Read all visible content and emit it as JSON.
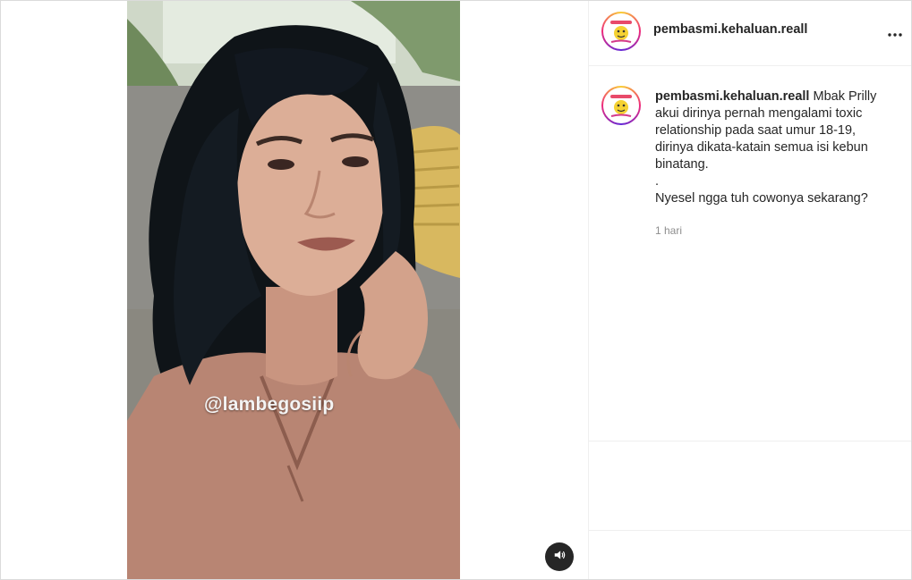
{
  "post": {
    "username": "pembasmi.kehaluan.reall",
    "more_icon": "more-horizontal-icon",
    "avatar_icon": "profile-avatar-icon"
  },
  "media": {
    "watermark": "@lambegosiip",
    "audio_icon": "speaker-volume-icon"
  },
  "caption": {
    "username": "pembasmi.kehaluan.reall",
    "text": " Mbak Prilly akui dirinya pernah mengalami toxic relationship pada saat umur 18-19, dirinya dikata-katain semua isi kebun binatang.\n.\nNyesel ngga tuh cowonya sekarang?",
    "timestamp": "1 hari"
  },
  "colors": {
    "text": "#262626",
    "muted": "#8e8e8e",
    "border": "#dbdbdb",
    "audio_button": "#262626"
  }
}
